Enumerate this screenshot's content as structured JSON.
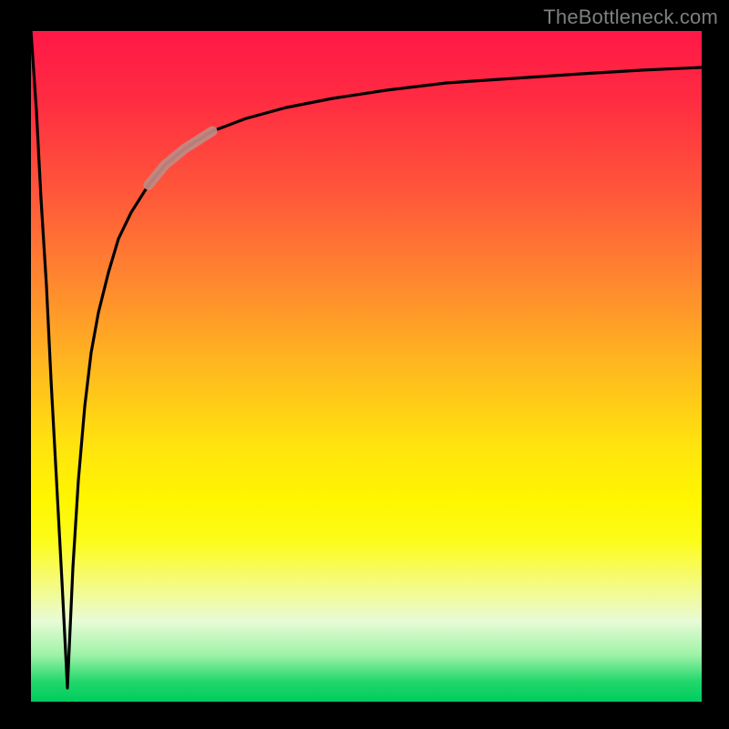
{
  "attribution": "TheBottleneck.com",
  "colors": {
    "frame": "#000000",
    "curve_main": "#000000",
    "highlight_segment": "#c28a83",
    "label": "#7f7f7f",
    "gradient_top": "#ff1846",
    "gradient_mid": "#ffe40e",
    "gradient_bottom": "#00cc5e"
  },
  "chart_data": {
    "type": "line",
    "title": "",
    "xlabel": "",
    "ylabel": "",
    "xlim": [
      0,
      100
    ],
    "ylim": [
      0,
      100
    ],
    "grid": false,
    "legend": false,
    "series": [
      {
        "name": "bottleneck-curve-descent",
        "x": [
          0.0,
          0.8,
          1.5,
          2.3,
          3.0,
          3.8,
          4.6,
          5.4
        ],
        "values": [
          100,
          88,
          75,
          62,
          48,
          33,
          18,
          2
        ]
      },
      {
        "name": "bottleneck-curve-ascent",
        "x": [
          5.4,
          6.2,
          7.0,
          8.0,
          9.0,
          10.0,
          11.5,
          13.0,
          15.0,
          17.5,
          20.0,
          23.0,
          27.0,
          32.0,
          38.0,
          45.0,
          53.0,
          62.0,
          72.0,
          82.0,
          91.0,
          100.0
        ],
        "values": [
          2,
          20,
          33,
          44,
          52,
          58,
          64,
          69,
          73,
          77,
          80,
          82.5,
          85,
          87,
          88.6,
          90,
          91.2,
          92.2,
          93,
          93.6,
          94.1,
          94.5
        ]
      },
      {
        "name": "highlighted-segment",
        "x": [
          17.5,
          20.0,
          23.0,
          27.0
        ],
        "values": [
          77,
          80,
          82.5,
          85
        ]
      }
    ]
  }
}
